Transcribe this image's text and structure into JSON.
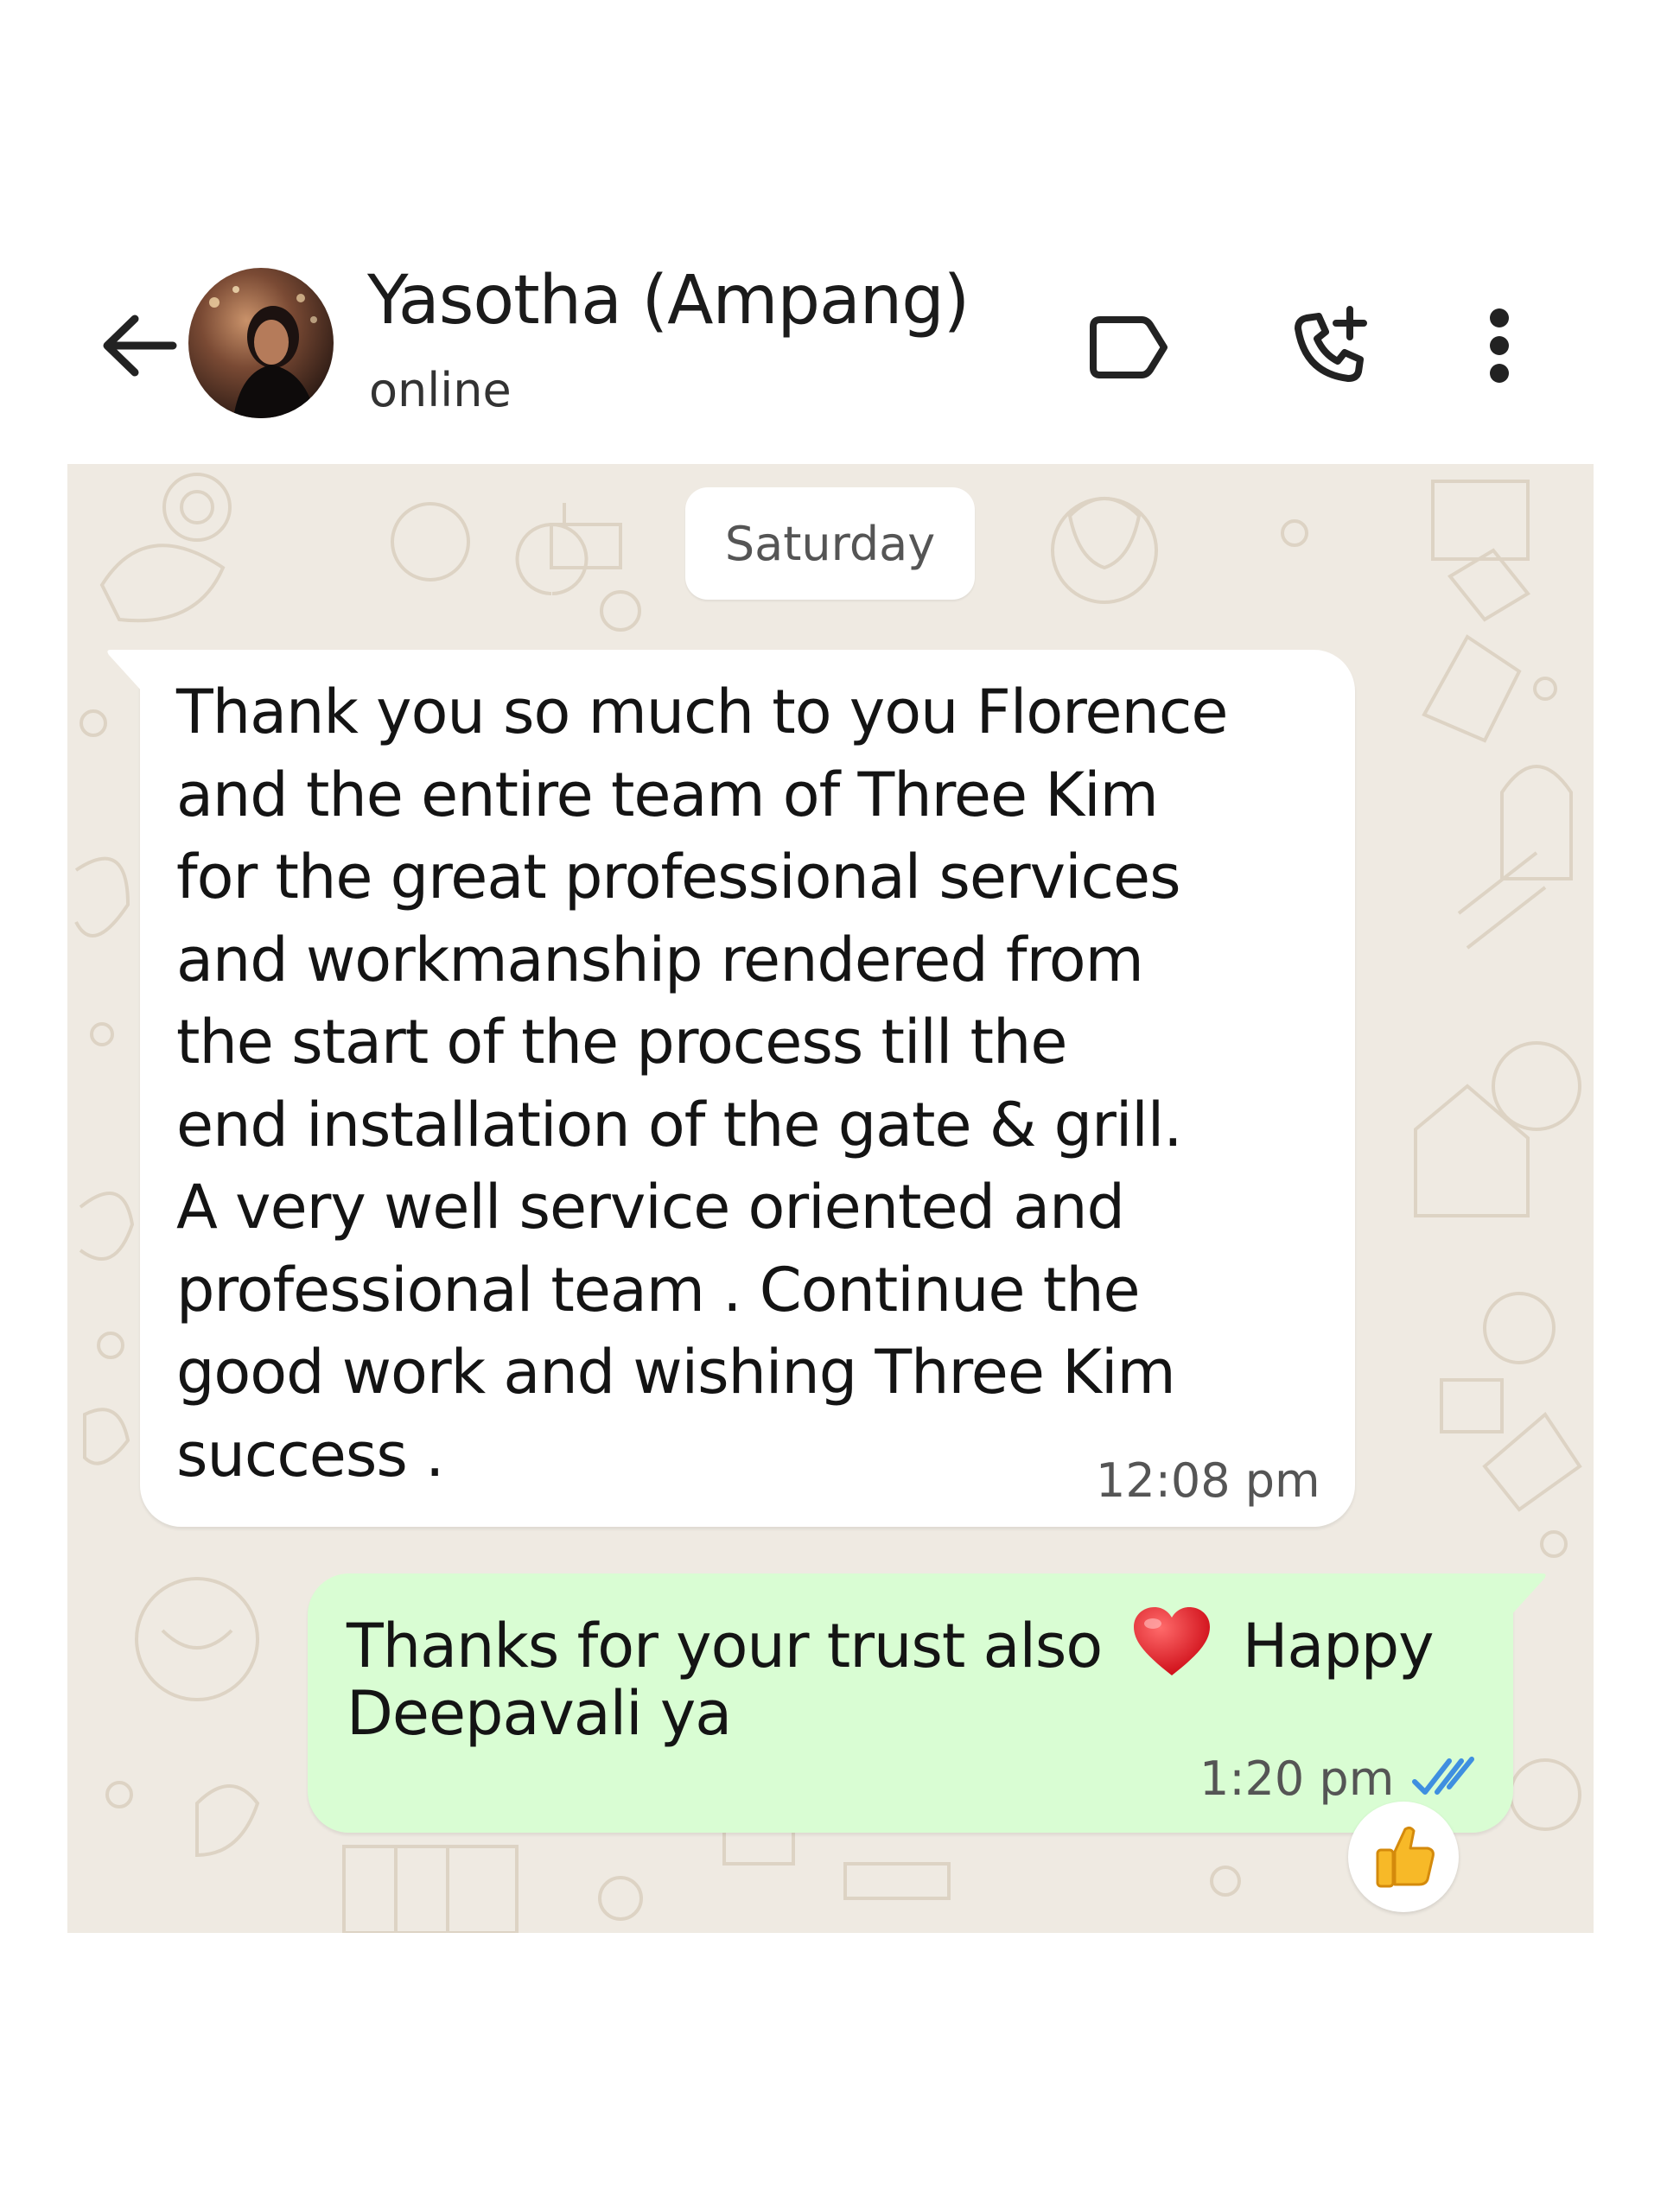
{
  "header": {
    "contact_name": "Yasotha (Ampang)",
    "status": "online",
    "icons": [
      "back-arrow-icon",
      "label-icon",
      "add-call-icon",
      "more-vert-icon"
    ]
  },
  "chat": {
    "date_chip": "Saturday",
    "messages": [
      {
        "direction": "incoming",
        "text": "Thank you so much to you Florence\nand the entire team of Three Kim\nfor the great professional services\nand workmanship rendered from\nthe start of the process till the\nend installation  of the gate & grill.\nA very well service oriented and\nprofessional team . Continue the\ngood work and wishing Three Kim\nsuccess .",
        "time": "12:08 pm"
      },
      {
        "direction": "outgoing",
        "text_line1": "Thanks for your trust also",
        "emoji": "❤️",
        "text_line1_end": "Happy",
        "text_line2": "Deepavali ya",
        "time": "1:20 pm",
        "status": "read",
        "reaction": "👍"
      }
    ]
  },
  "colors": {
    "chat_background": "#efeae2",
    "incoming_bubble": "#ffffff",
    "outgoing_bubble": "#d9fdd3",
    "read_ticks": "#3f8fe0"
  }
}
